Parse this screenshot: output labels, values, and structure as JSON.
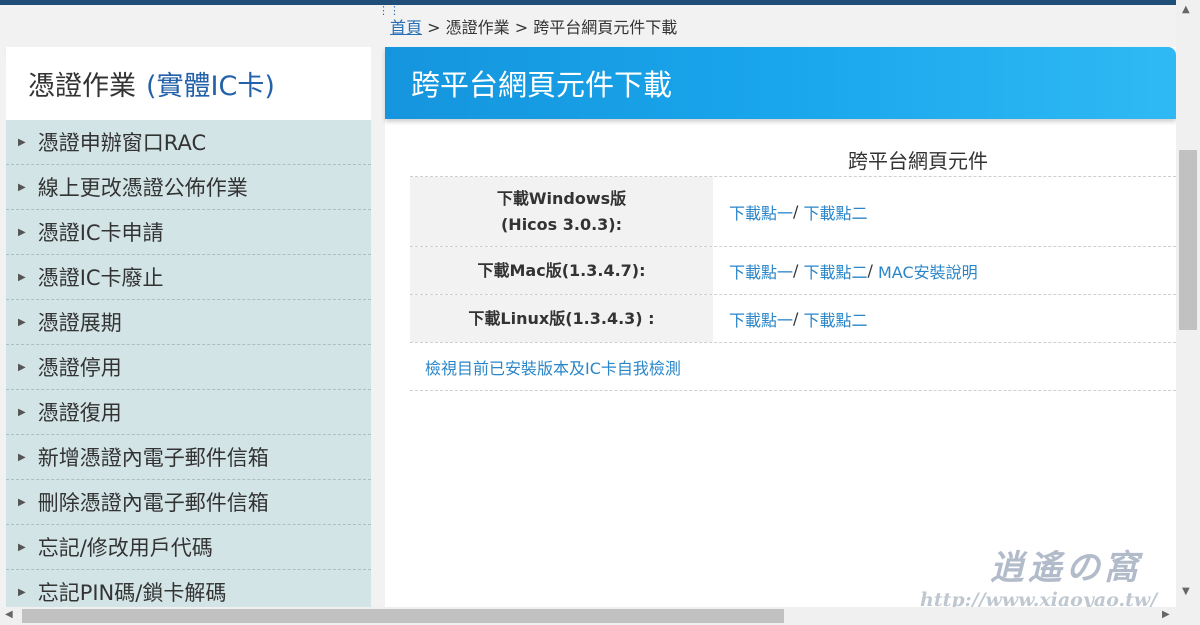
{
  "breadcrumb": {
    "home": "首頁",
    "sep1": ">",
    "level1": "憑證作業",
    "sep2": ">",
    "current": "跨平台網頁元件下載"
  },
  "sidebar": {
    "title": "憑證作業",
    "subtitle": "(實體IC卡)",
    "items": [
      {
        "label": "憑證申辦窗口RAC"
      },
      {
        "label": "線上更改憑證公佈作業"
      },
      {
        "label": "憑證IC卡申請"
      },
      {
        "label": "憑證IC卡廢止"
      },
      {
        "label": "憑證展期"
      },
      {
        "label": "憑證停用"
      },
      {
        "label": "憑證復用"
      },
      {
        "label": "新增憑證內電子郵件信箱"
      },
      {
        "label": "刪除憑證內電子郵件信箱"
      },
      {
        "label": "忘記/修改用戶代碼"
      },
      {
        "label": "忘記PIN碼/鎖卡解碼"
      }
    ]
  },
  "main": {
    "page_title": "跨平台網頁元件下載",
    "table_caption": "跨平台網頁元件",
    "rows": [
      {
        "label_line1": "下載Windows版",
        "label_line2": "(Hicos 3.0.3):",
        "link1": "下載點一",
        "link2": "下載點二"
      },
      {
        "label": "下載Mac版(1.3.4.7):",
        "link1": "下載點一",
        "link2": "下載點二",
        "link3": "MAC安裝說明"
      },
      {
        "label": "下載Linux版(1.3.4.3) :",
        "link1": "下載點一",
        "link2": "下載點二"
      }
    ],
    "separator": "/",
    "check_link": "檢視目前已安裝版本及IC卡自我檢測"
  },
  "watermark": {
    "title": "逍遙の窩",
    "url": "http://www.xiaoyao.tw/"
  },
  "colors": {
    "link": "#2a86c9",
    "banner": "#19a6ec",
    "sidebar_bg": "#d3e4e6"
  }
}
